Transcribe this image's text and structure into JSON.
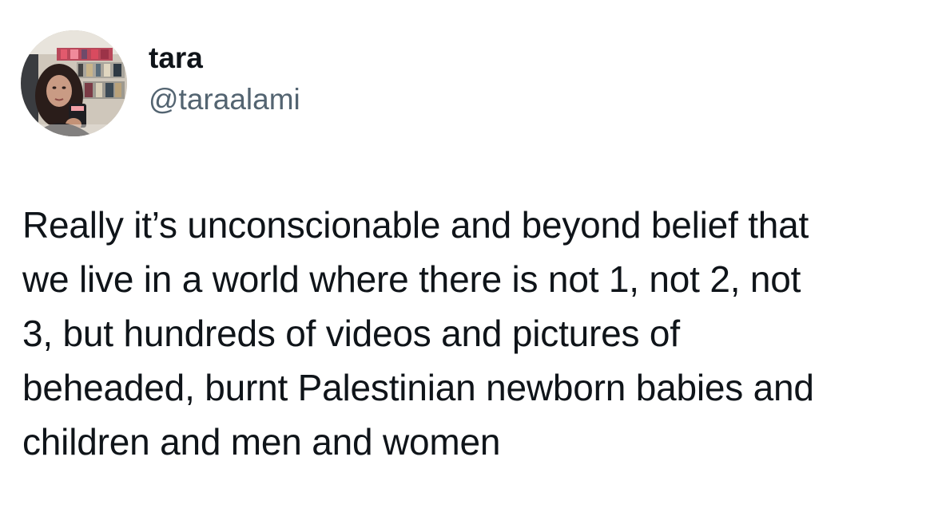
{
  "tweet": {
    "author": {
      "display_name": "tara",
      "handle": "@taraalami",
      "avatar_icon": "profile-photo-avatar"
    },
    "text_lines": [
      "Really it’s unconscionable and beyond belief that",
      "we live in a world where there is not 1, not 2, not",
      "3, but hundreds of videos and pictures of",
      "beheaded, burnt Palestinian newborn babies and",
      "children and men and women"
    ]
  },
  "colors": {
    "text_primary": "#0f1419",
    "text_secondary": "#536471",
    "background": "#ffffff"
  }
}
